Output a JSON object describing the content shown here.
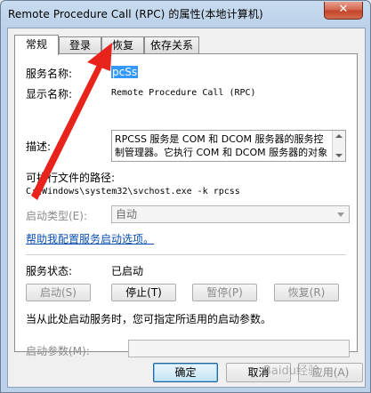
{
  "window": {
    "title": "Remote Procedure Call (RPC) 的属性(本地计算机)",
    "close_glyph": "✕"
  },
  "tabs": [
    {
      "label": "常规",
      "active": true
    },
    {
      "label": "登录",
      "active": false
    },
    {
      "label": "恢复",
      "active": false
    },
    {
      "label": "依存关系",
      "active": false
    }
  ],
  "general": {
    "service_name_label": "服务名称:",
    "service_name_value": "RpcSs",
    "service_name_visible": "pcSs",
    "display_name_label": "显示名称:",
    "display_name_value": "Remote Procedure Call (RPC)",
    "description_label": "描述:",
    "description_text": "RPCSS 服务是 COM 和 DCOM 服务器的服务控制管理器。它执行 COM 和 DCOM 服务器的对象激",
    "exe_path_label": "可执行文件的路径:",
    "exe_path_value": "C:\\Windows\\system32\\svchost.exe -k rpcss",
    "startup_type_label": "启动类型(E):",
    "startup_type_value": "自动",
    "help_link": "帮助我配置服务启动选项。",
    "service_status_label": "服务状态:",
    "service_status_value": "已启动",
    "buttons": {
      "start": "启动(S)",
      "stop": "停止(T)",
      "pause": "暂停(P)",
      "resume": "恢复(R)"
    },
    "hint_text": "当从此处启动服务时，您可指定所适用的启动参数。",
    "start_params_label": "启动参数(M):",
    "start_params_value": ""
  },
  "footer": {
    "ok": "确定",
    "cancel": "取消",
    "apply": "应用(A)"
  },
  "colors": {
    "annotation_arrow": "#e8231c",
    "link": "#0b4fb0",
    "selection": "#3399ff"
  },
  "watermark": "Baidu经验"
}
